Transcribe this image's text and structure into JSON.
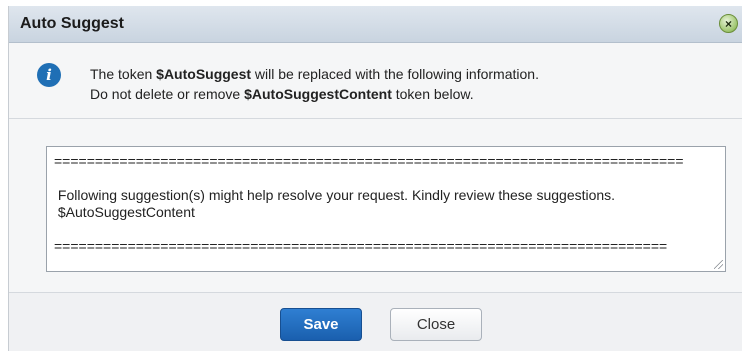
{
  "dialog": {
    "title": "Auto Suggest",
    "close_icon": "×"
  },
  "info": {
    "line1_pre": "The token ",
    "line1_token": "$AutoSuggest",
    "line1_post": " will be replaced with the following information.",
    "line2_pre": "Do not delete or remove ",
    "line2_token": "$AutoSuggestContent",
    "line2_post": " token below."
  },
  "editor": {
    "content": "=============================================================================\n\n Following suggestion(s) might help resolve your request. Kindly review these suggestions.\n $AutoSuggestContent\n\n==========================================================================="
  },
  "buttons": {
    "save": "Save",
    "close": "Close"
  }
}
